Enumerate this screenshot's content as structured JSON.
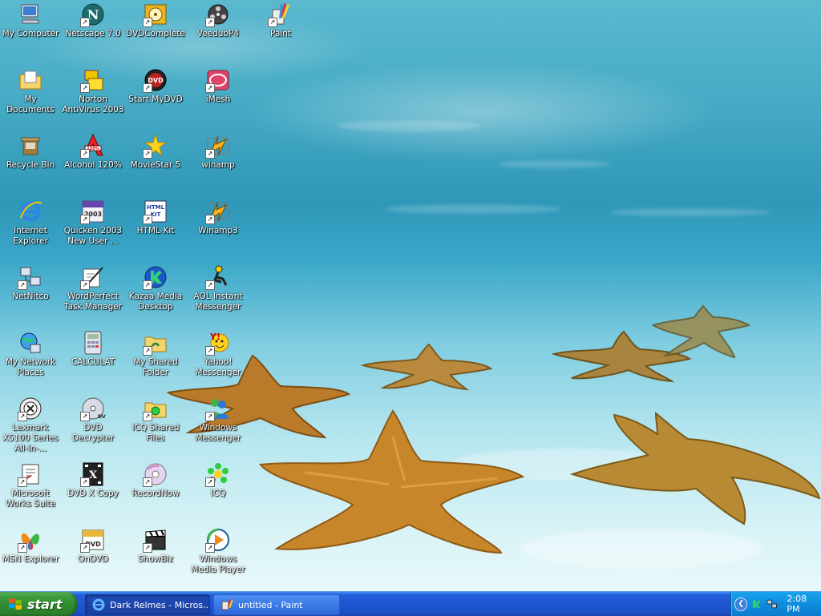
{
  "desktop": {
    "icons": [
      {
        "label": "My Computer",
        "icon": "computer-icon",
        "col": 0,
        "row": 0,
        "shortcut": false
      },
      {
        "label": "Netscape 7.0",
        "icon": "netscape-icon",
        "col": 1,
        "row": 0,
        "shortcut": true
      },
      {
        "label": "DVDComplete",
        "icon": "dvdcomplete-icon",
        "col": 2,
        "row": 0,
        "shortcut": true
      },
      {
        "label": "VeedubP4",
        "icon": "film-reel-icon",
        "col": 3,
        "row": 0,
        "shortcut": true
      },
      {
        "label": "Paint",
        "icon": "paint-icon",
        "col": 4,
        "row": 0,
        "shortcut": true
      },
      {
        "label": "My Documents",
        "icon": "documents-folder-icon",
        "col": 0,
        "row": 1,
        "shortcut": false
      },
      {
        "label": "Norton AntiVirus 2003",
        "icon": "norton-icon",
        "col": 1,
        "row": 1,
        "shortcut": true
      },
      {
        "label": "Start MyDVD",
        "icon": "mydvd-icon",
        "col": 2,
        "row": 1,
        "shortcut": true
      },
      {
        "label": "iMesh",
        "icon": "imesh-icon",
        "col": 3,
        "row": 1,
        "shortcut": true
      },
      {
        "label": "Recycle Bin",
        "icon": "recycle-bin-icon",
        "col": 0,
        "row": 2,
        "shortcut": false
      },
      {
        "label": "Alcohol 120%",
        "icon": "alcohol-icon",
        "col": 1,
        "row": 2,
        "shortcut": true
      },
      {
        "label": "MovieStar 5",
        "icon": "star-icon",
        "col": 2,
        "row": 2,
        "shortcut": true
      },
      {
        "label": "winamp",
        "icon": "winamp-icon",
        "col": 3,
        "row": 2,
        "shortcut": true
      },
      {
        "label": "Internet Explorer",
        "icon": "internet-explorer-icon",
        "col": 0,
        "row": 3,
        "shortcut": false
      },
      {
        "label": "Quicken 2003 New User ...",
        "icon": "quicken-icon",
        "col": 1,
        "row": 3,
        "shortcut": true
      },
      {
        "label": "HTML-Kit",
        "icon": "html-kit-icon",
        "col": 2,
        "row": 3,
        "shortcut": true
      },
      {
        "label": "Winamp3",
        "icon": "winamp-icon",
        "col": 3,
        "row": 3,
        "shortcut": true
      },
      {
        "label": "NetNitco",
        "icon": "network-computer-icon",
        "col": 0,
        "row": 4,
        "shortcut": true
      },
      {
        "label": "WordPerfect Task Manager",
        "icon": "wordperfect-icon",
        "col": 1,
        "row": 4,
        "shortcut": true
      },
      {
        "label": "Kazaa Media Desktop",
        "icon": "kazaa-icon",
        "col": 2,
        "row": 4,
        "shortcut": true
      },
      {
        "label": "AOL Instant Messenger",
        "icon": "aim-icon",
        "col": 3,
        "row": 4,
        "shortcut": true
      },
      {
        "label": "My Network Places",
        "icon": "network-places-icon",
        "col": 0,
        "row": 5,
        "shortcut": false
      },
      {
        "label": "CALCULAT",
        "icon": "calculator-icon",
        "col": 1,
        "row": 5,
        "shortcut": false
      },
      {
        "label": "My Shared Folder",
        "icon": "shared-folder-icon",
        "col": 2,
        "row": 5,
        "shortcut": true
      },
      {
        "label": "Yahoo! Messenger",
        "icon": "yahoo-messenger-icon",
        "col": 3,
        "row": 5,
        "shortcut": true
      },
      {
        "label": "Lexmark X5100 Series All-In-...",
        "icon": "lexmark-icon",
        "col": 0,
        "row": 6,
        "shortcut": true
      },
      {
        "label": "DVD Decrypter",
        "icon": "dvd-disc-icon",
        "col": 1,
        "row": 6,
        "shortcut": true
      },
      {
        "label": "ICQ Shared Files",
        "icon": "icq-folder-icon",
        "col": 2,
        "row": 6,
        "shortcut": true
      },
      {
        "label": "Windows Messenger",
        "icon": "windows-messenger-icon",
        "col": 3,
        "row": 6,
        "shortcut": true
      },
      {
        "label": "Microsoft Works Suite",
        "icon": "works-suite-icon",
        "col": 0,
        "row": 7,
        "shortcut": true
      },
      {
        "label": "DVD X Copy",
        "icon": "dvd-x-copy-icon",
        "col": 1,
        "row": 7,
        "shortcut": true
      },
      {
        "label": "RecordNow",
        "icon": "cd-icon",
        "col": 2,
        "row": 7,
        "shortcut": true
      },
      {
        "label": "ICQ",
        "icon": "icq-flower-icon",
        "col": 3,
        "row": 7,
        "shortcut": true
      },
      {
        "label": "MSN Explorer",
        "icon": "msn-butterfly-icon",
        "col": 0,
        "row": 8,
        "shortcut": true
      },
      {
        "label": "OnDVD",
        "icon": "ondvd-icon",
        "col": 1,
        "row": 8,
        "shortcut": true
      },
      {
        "label": "ShowBiz",
        "icon": "clapperboard-icon",
        "col": 2,
        "row": 8,
        "shortcut": true
      },
      {
        "label": "Windows Media Player",
        "icon": "media-player-icon",
        "col": 3,
        "row": 8,
        "shortcut": true
      }
    ]
  },
  "taskbar": {
    "start_label": "start",
    "tasks": [
      {
        "label": "Dark Relmes - Micros...",
        "icon": "internet-explorer-icon",
        "active": false
      },
      {
        "label": "untitled - Paint",
        "icon": "paint-icon",
        "active": true
      }
    ],
    "tray": {
      "icons": [
        "kazaa-tray-icon",
        "network-tray-icon"
      ],
      "clock": "2:08 PM"
    }
  }
}
